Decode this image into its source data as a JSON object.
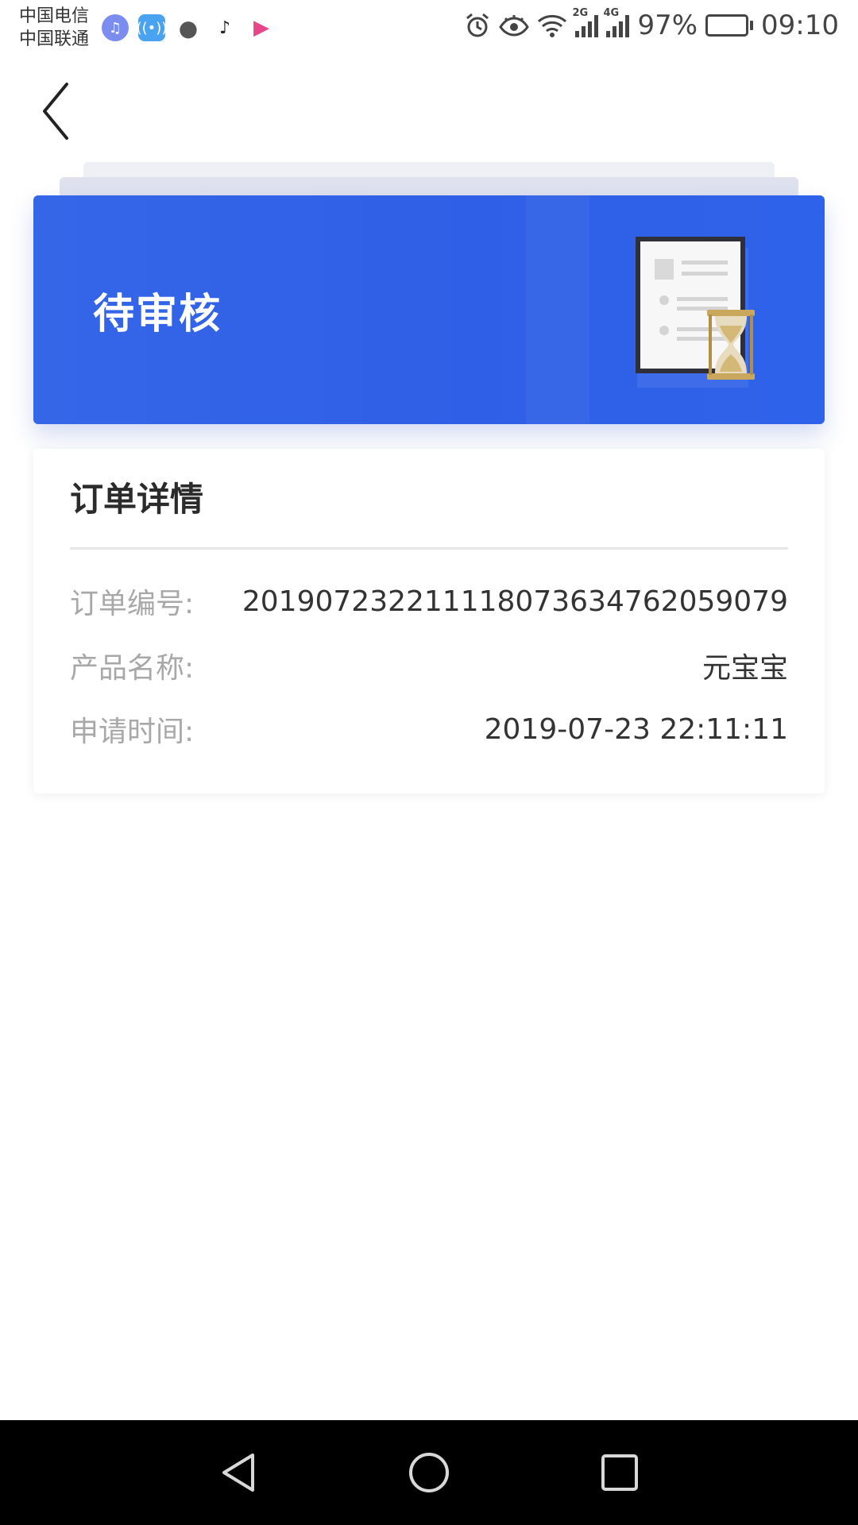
{
  "status_bar": {
    "carrier_1": "中国电信",
    "carrier_2": "中国联通",
    "notification_icons": [
      "music-icon",
      "radio-icon",
      "chat-icon",
      "tiktok-icon",
      "youku-icon"
    ],
    "network_1": "2G",
    "network_2": "4G",
    "battery_percent": "97%",
    "battery_level": 0.97,
    "time": "09:10"
  },
  "header": {
    "back_icon": "chevron-left-icon"
  },
  "status_card": {
    "title": "待审核",
    "illustration": "document-hourglass-icon",
    "accent_color": "#3566e8"
  },
  "order": {
    "title": "订单详情",
    "fields": [
      {
        "label": "订单编号:",
        "value": "20190723221111807363476205907​9"
      },
      {
        "label": "产品名称:",
        "value": "元宝宝"
      },
      {
        "label": "申请时间:",
        "value": "2019-07-23 22:11:11"
      }
    ]
  },
  "nav_bar": {
    "icons": [
      "nav-back-icon",
      "nav-home-icon",
      "nav-recents-icon"
    ]
  }
}
